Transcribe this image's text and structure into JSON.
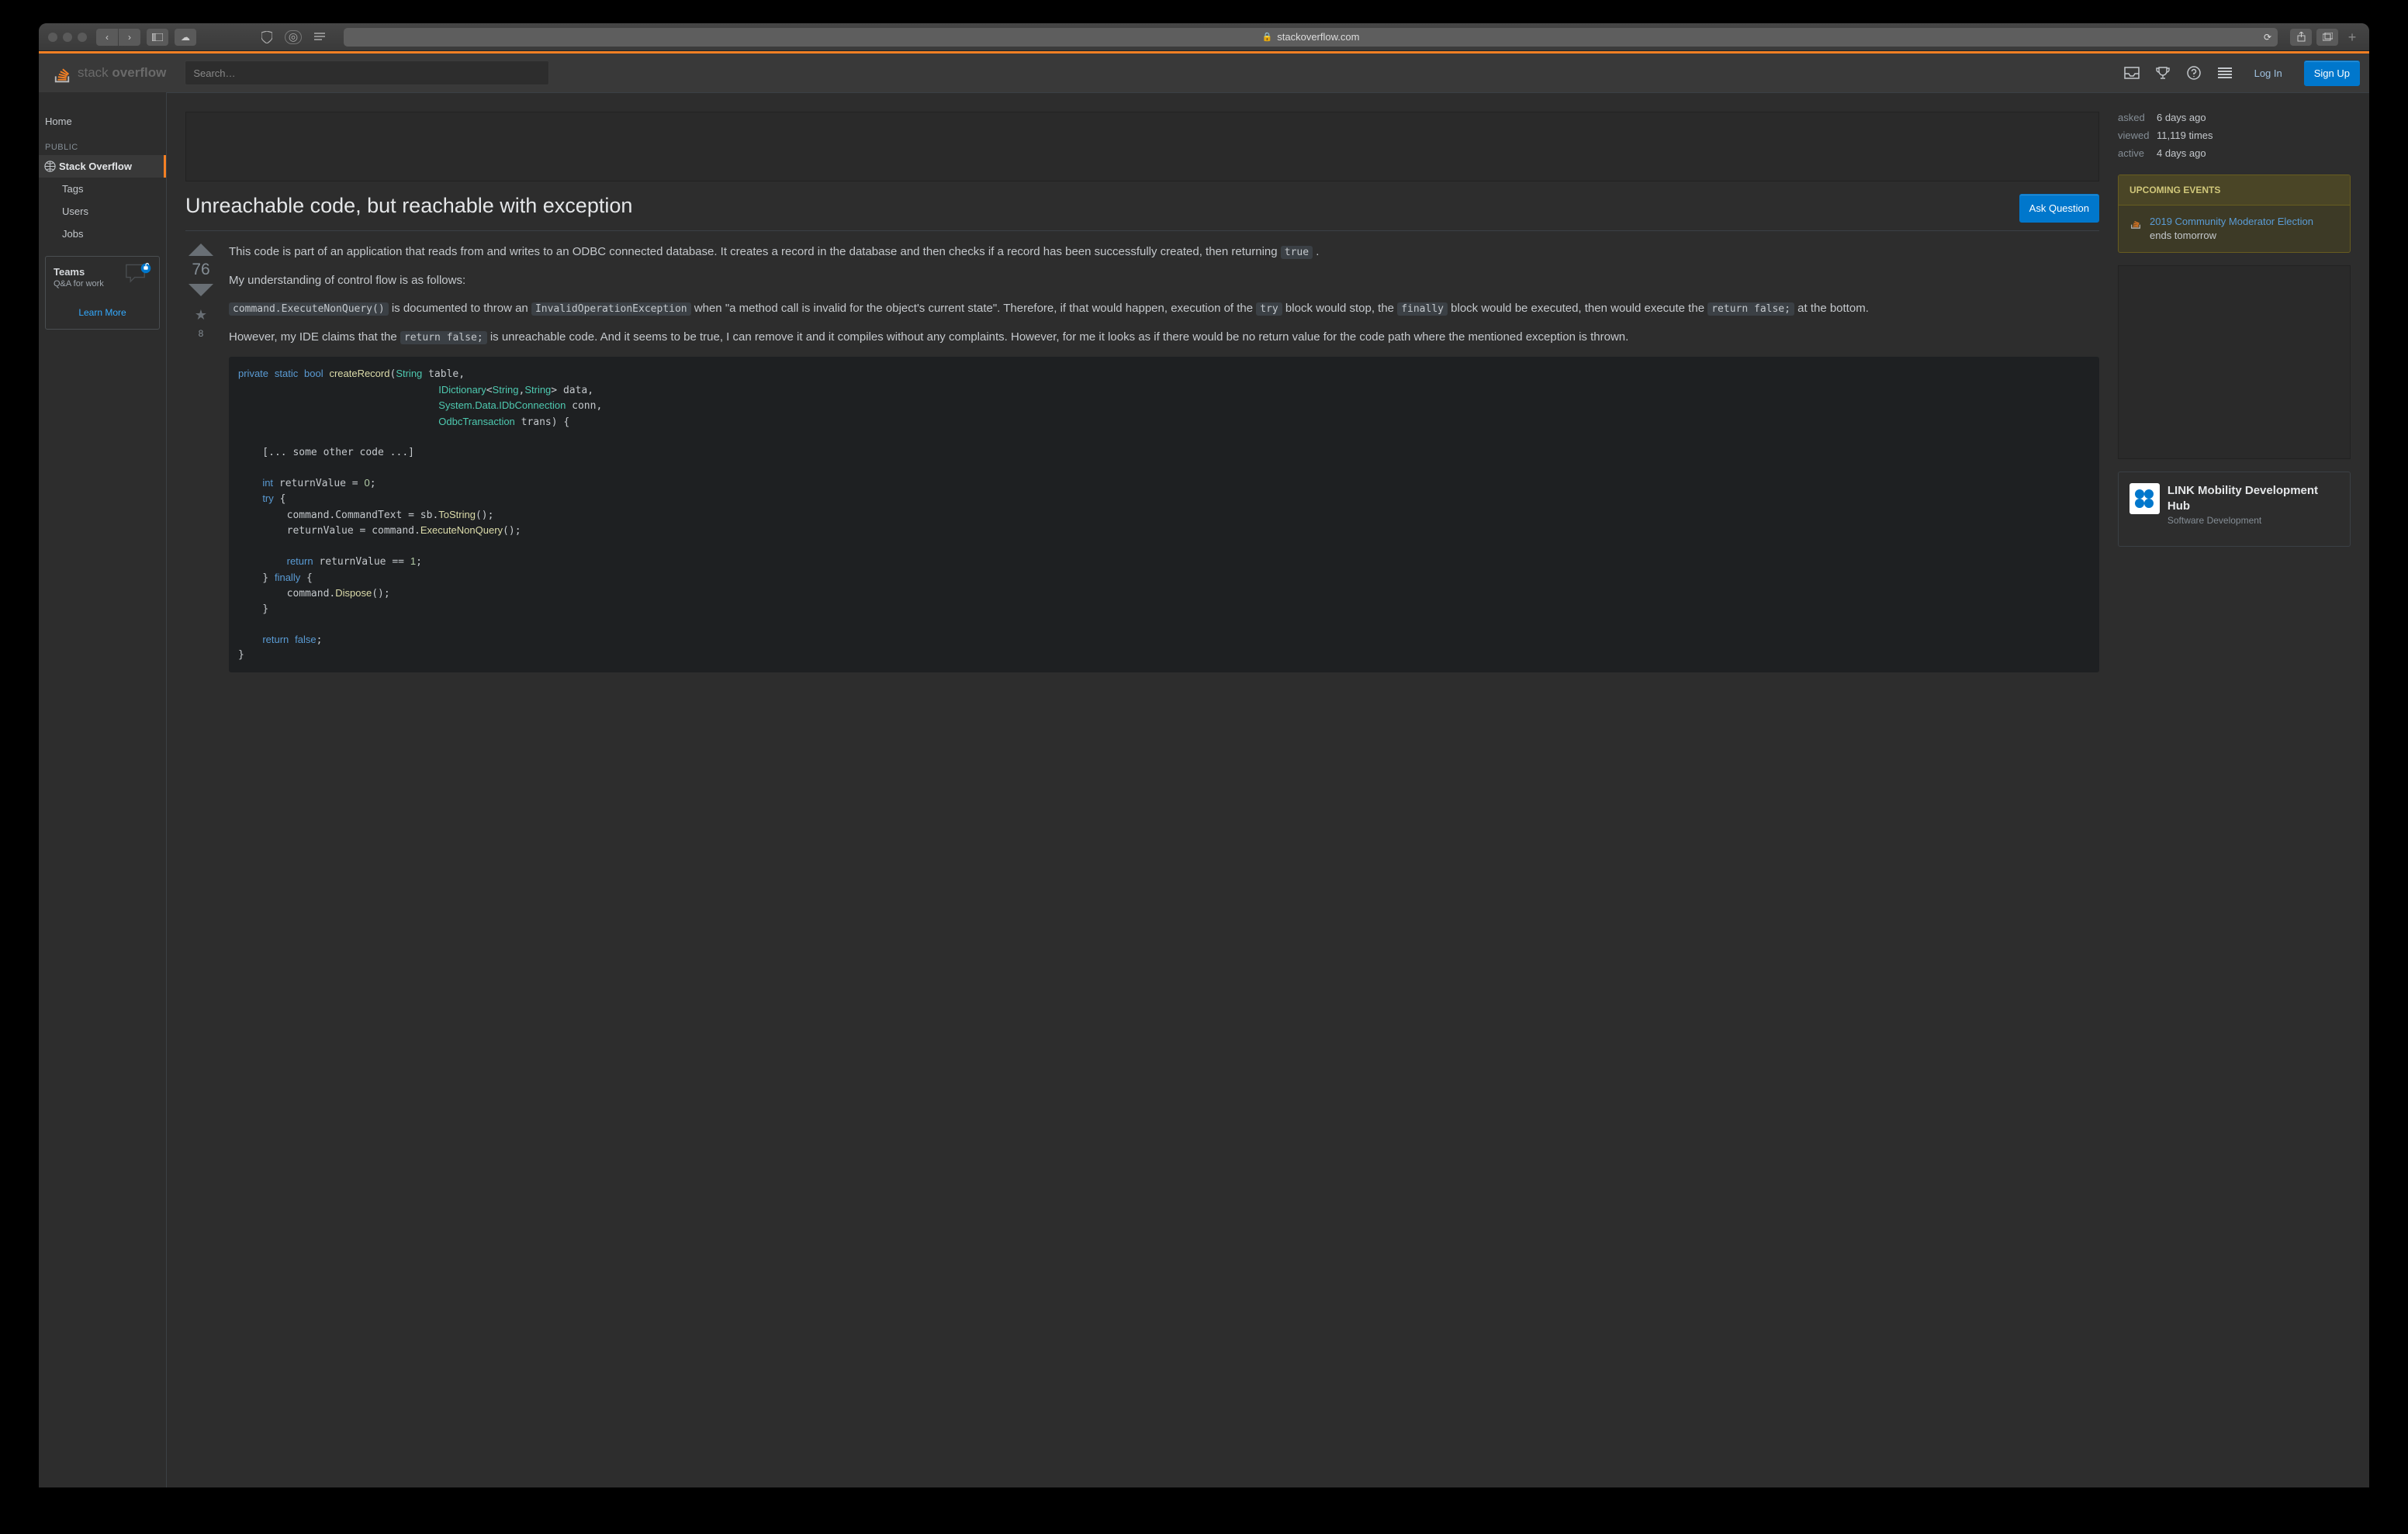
{
  "browser": {
    "url": "stackoverflow.com"
  },
  "logo_text_a": "stack",
  "logo_text_b": "overflow",
  "search_placeholder": "Search…",
  "login": "Log In",
  "signup": "Sign Up",
  "sidebar": {
    "home": "Home",
    "public": "PUBLIC",
    "items": [
      "Stack Overflow",
      "Tags",
      "Users",
      "Jobs"
    ]
  },
  "teams": {
    "title": "Teams",
    "sub": "Q&A for work",
    "learn": "Learn More"
  },
  "question": {
    "title": "Unreachable code, but reachable with exception",
    "ask": "Ask Question",
    "score": "76",
    "favs": "8",
    "p1a": "This code is part of an application that reads from and writes to an ODBC connected database. It creates a record in the database and then checks if a record has been successfully created, then returning ",
    "p1code": "true",
    "p1b": " .",
    "p2": "My understanding of control flow is as follows:",
    "p3_c1": "command.ExecuteNonQuery()",
    "p3_t1": " is documented to throw an ",
    "p3_c2": "InvalidOperationException",
    "p3_t2": " when \"a method call is invalid for the object's current state\". Therefore, if that would happen, execution of the ",
    "p3_c3": "try",
    "p3_t3": " block would stop, the ",
    "p3_c4": "finally",
    "p3_t4": " block would be executed, then would execute the ",
    "p3_c5": "return false;",
    "p3_t5": " at the bottom.",
    "p4_t1": "However, my IDE claims that the ",
    "p4_c1": "return false;",
    "p4_t2": " is unreachable code. And it seems to be true, I can remove it and it compiles without any complaints. However, for me it looks as if there would be no return value for the code path where the mentioned exception is thrown."
  },
  "stats": {
    "asked_l": "asked",
    "asked_v": "6 days ago",
    "viewed_l": "viewed",
    "viewed_v": "11,119 times",
    "active_l": "active",
    "active_v": "4 days ago"
  },
  "events": {
    "head": "UPCOMING EVENTS",
    "link": "2019 Community Moderator Election",
    "sub": "ends tomorrow"
  },
  "jobs": {
    "title": "LINK Mobility Development Hub",
    "sub": "Software Development",
    "line": ""
  }
}
